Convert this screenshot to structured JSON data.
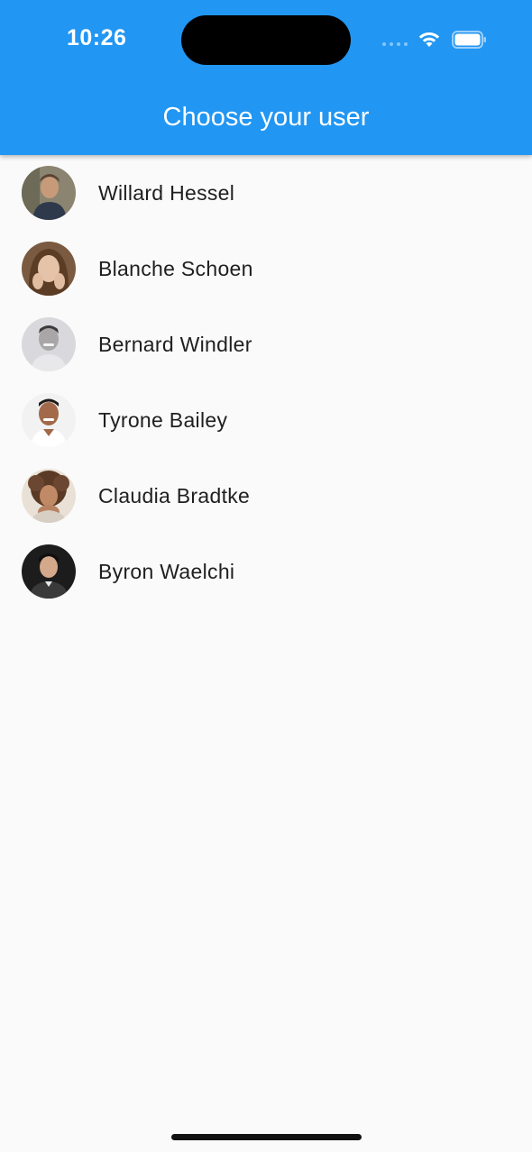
{
  "status_bar": {
    "time": "10:26"
  },
  "appbar": {
    "title": "Choose your user",
    "color": "#2196f3"
  },
  "users": [
    {
      "name": "Willard Hessel",
      "avatar": "person-photo"
    },
    {
      "name": "Blanche Schoen",
      "avatar": "person-photo"
    },
    {
      "name": "Bernard Windler",
      "avatar": "person-photo"
    },
    {
      "name": "Tyrone Bailey",
      "avatar": "person-photo"
    },
    {
      "name": "Claudia Bradtke",
      "avatar": "person-photo"
    },
    {
      "name": "Byron Waelchi",
      "avatar": "person-photo"
    }
  ]
}
